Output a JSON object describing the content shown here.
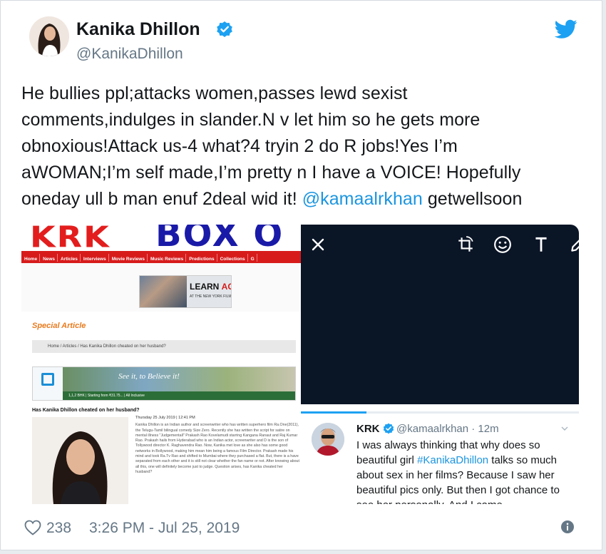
{
  "tweet": {
    "author": {
      "name": "Kanika Dhillon",
      "handle": "@KanikaDhillon",
      "verified": true
    },
    "text_lines": [
      "He bullies ppl;attacks women,passes lewd sexist",
      "comments,indulges in slander.N v let him so he gets more",
      "obnoxious!Attack us-4 what?4 tryin 2 do R jobs!Yes I’m",
      "aWOMAN;I’m self made,I’m pretty n I have a VOICE! Hopefully"
    ],
    "last_line_prefix": "oneday ull b man enuf 2deal wid it! ",
    "mention": "@kamaalrkhan",
    "last_line_suffix": " getwellsoon",
    "likes": "238",
    "timestamp": "3:26 PM - Jul 25, 2019"
  },
  "screenshot_left": {
    "logo_left": "KRK",
    "logo_right": "BOX O",
    "nav_items": [
      "Home",
      "News",
      "Articles",
      "Interviews",
      "Movie Reviews",
      "Music Reviews",
      "Predictions",
      "Collections",
      "G"
    ],
    "ad1_title_a": "LEARN ",
    "ad1_title_b": "ACTING",
    "ad1_sub": "AT THE NEW YORK FILM",
    "section_title": "Special Article",
    "breadcrumb": "Home / Articles / Has Kanika Dhillon cheated on her husband?",
    "ad2_tagline": "See it, to Believe it!",
    "ad2_bar": "1,1,2 BHK  |  Starting from ₹31.75...  |  All Inclusive",
    "headline": "Has Kanika Dhillon cheated on her husband?",
    "date": "Thursday 25 July 2019 | 12:41 PM",
    "body": "Kanika Dhillon is an Indian author and screenwriter who has written superhero film Ra.One(2011), the Telugu-Tamil bilingual comedy Size Zero. Recently she has written the script for satire on mental illness \"Judgementall\" Prakash Rao Kovelamudi starring Kangana Ranaut and Raj Kumar Rao. Prakash hails from Hyderabad who is an Indian actor, screenwriter and D is the son of Tollywood director K. Raghavendra Rao. Now, Kanika met love as she also has some good networks in Bollywood, making him mean him being a famous Film Director. Prakash made his mind and took Ra.Tv Rao and shifted to Mumbai where they purchased a flat. But, there is a have separated from each other and it is still not clear whether the fan name or not. After knowing about all this, one will definitely become just to judge. Question arises, has Kanika cheated her husband?"
  },
  "screenshot_right": {
    "quoted_tweet": {
      "name": "KRK",
      "handle": "@kamaalrkhan · 12m",
      "text_a": "I was always thinking that why does so beautiful girl ",
      "hashtag": "#KanikaDhillon",
      "text_b": " talks so much about sex in her films? Because I saw her beautiful pics only. But then I got chance to see her personally. And I came"
    }
  },
  "colors": {
    "twitter_blue": "#1da1f2",
    "link_blue": "#1b95e0",
    "secondary_text": "#657786",
    "krk_red": "#d71b1b"
  }
}
